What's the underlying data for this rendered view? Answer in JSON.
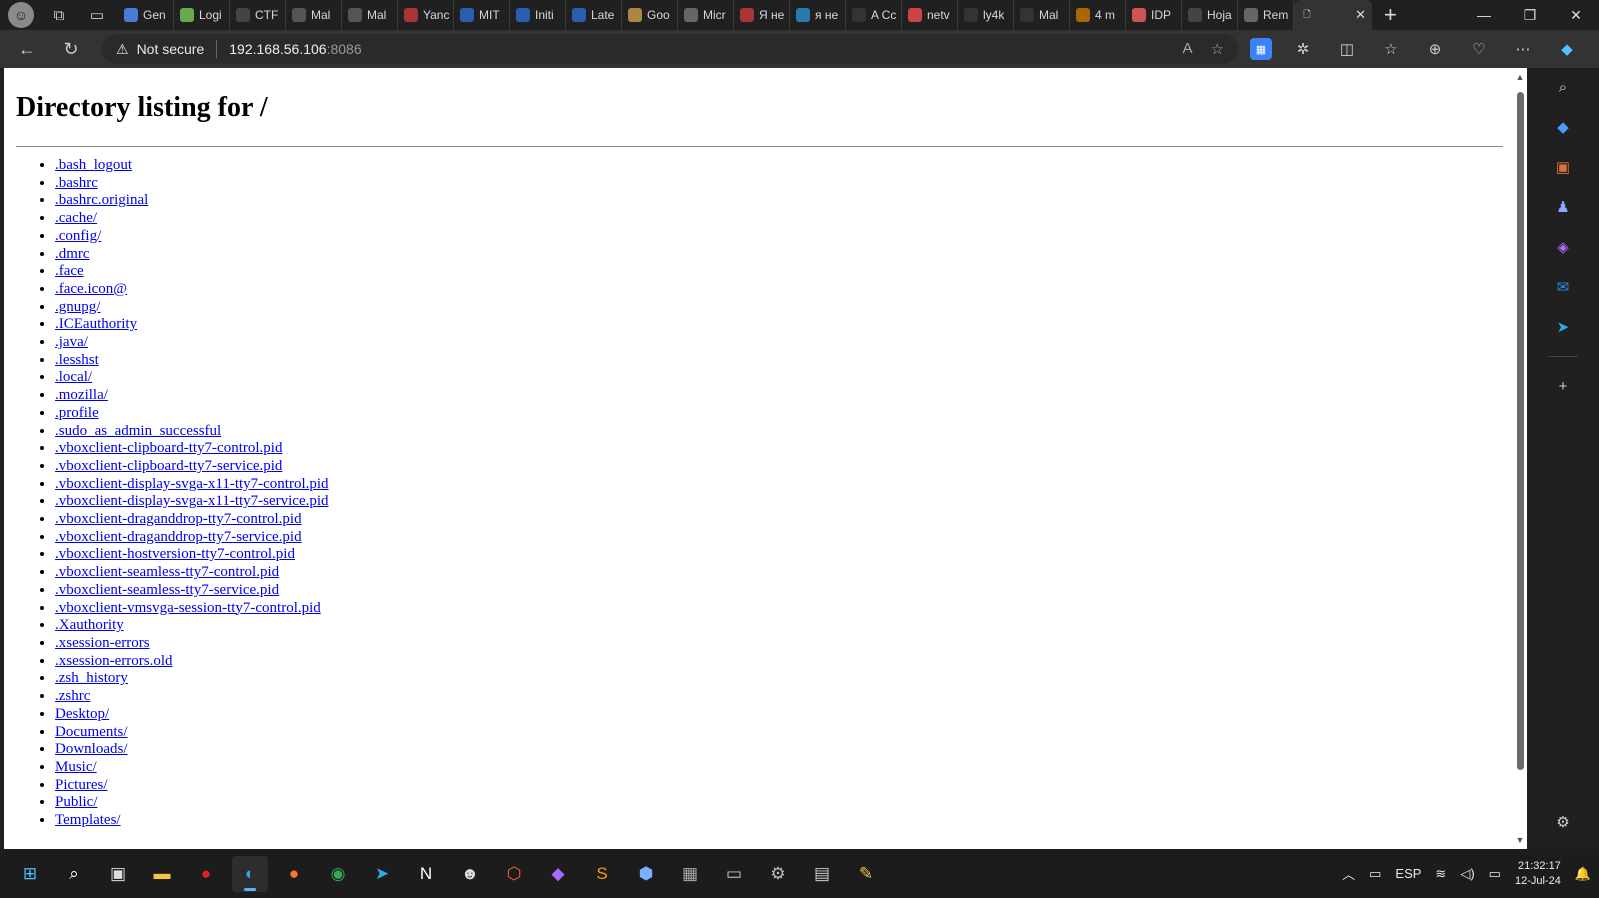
{
  "browser": {
    "tabs": [
      {
        "label": "Gen",
        "icon": "spark-icon",
        "color": "#4a7bd6"
      },
      {
        "label": "Logi",
        "icon": "cube-icon",
        "color": "#6aa84f"
      },
      {
        "label": "CTF",
        "icon": "flag-icon",
        "color": "#444444"
      },
      {
        "label": "Mal",
        "icon": "box-icon",
        "color": "#555555"
      },
      {
        "label": "Mal",
        "icon": "box-icon",
        "color": "#555555"
      },
      {
        "label": "Yanc",
        "icon": "yandex-icon",
        "color": "#a33"
      },
      {
        "label": "MIT",
        "icon": "m-icon",
        "color": "#2a5db0"
      },
      {
        "label": "Initi",
        "icon": "m-icon",
        "color": "#2a5db0"
      },
      {
        "label": "Late",
        "icon": "m-icon",
        "color": "#2a5db0"
      },
      {
        "label": "Goo",
        "icon": "leaf-icon",
        "color": "#a84"
      },
      {
        "label": "Micr",
        "icon": "g-icon",
        "color": "#666"
      },
      {
        "label": "Я не",
        "icon": "yandex-icon",
        "color": "#a33"
      },
      {
        "label": "я не",
        "icon": "search-icon",
        "color": "#2a7ab0"
      },
      {
        "label": "A Cc",
        "icon": "medium-icon",
        "color": "#333"
      },
      {
        "label": "netv",
        "icon": "ask-icon",
        "color": "#c44"
      },
      {
        "label": "ly4k",
        "icon": "github-icon",
        "color": "#333"
      },
      {
        "label": "Mal",
        "icon": "medium-icon",
        "color": "#333"
      },
      {
        "label": "4 m",
        "icon": "badge-icon",
        "color": "#a60"
      },
      {
        "label": "IDP",
        "icon": "blogger-icon",
        "color": "#c55"
      },
      {
        "label": "Hoja",
        "icon": "a-icon",
        "color": "#444"
      },
      {
        "label": "Rem",
        "icon": "g-icon",
        "color": "#666"
      }
    ],
    "active_tab_close": "✕",
    "new_tab": "+",
    "window_controls": {
      "minimize": "—",
      "restore": "❐",
      "close": "✕"
    },
    "back": "←",
    "reload": "↻",
    "security_label": "Not secure",
    "url_host": "192.168.56.106",
    "url_port": ":8086"
  },
  "page": {
    "title": "Directory listing for /",
    "entries": [
      ".bash_logout",
      ".bashrc",
      ".bashrc.original",
      ".cache/",
      ".config/",
      ".dmrc",
      ".face",
      ".face.icon@",
      ".gnupg/",
      ".ICEauthority",
      ".java/",
      ".lesshst",
      ".local/",
      ".mozilla/",
      ".profile",
      ".sudo_as_admin_successful",
      ".vboxclient-clipboard-tty7-control.pid",
      ".vboxclient-clipboard-tty7-service.pid",
      ".vboxclient-display-svga-x11-tty7-control.pid",
      ".vboxclient-display-svga-x11-tty7-service.pid",
      ".vboxclient-draganddrop-tty7-control.pid",
      ".vboxclient-draganddrop-tty7-service.pid",
      ".vboxclient-hostversion-tty7-control.pid",
      ".vboxclient-seamless-tty7-control.pid",
      ".vboxclient-seamless-tty7-service.pid",
      ".vboxclient-vmsvga-session-tty7-control.pid",
      ".Xauthority",
      ".xsession-errors",
      ".xsession-errors.old",
      ".zsh_history",
      ".zshrc",
      "Desktop/",
      "Documents/",
      "Downloads/",
      "Music/",
      "Pictures/",
      "Public/",
      "Templates/"
    ]
  },
  "taskbar": {
    "apps": [
      {
        "name": "start-button",
        "glyph": "⊞",
        "color": "#4cc2ff"
      },
      {
        "name": "search-button",
        "glyph": "⌕",
        "color": "#ffffff"
      },
      {
        "name": "task-view-button",
        "glyph": "▣",
        "color": "#dddddd"
      },
      {
        "name": "file-explorer-app",
        "glyph": "▬",
        "color": "#f5c542"
      },
      {
        "name": "antivirus-app",
        "glyph": "●",
        "color": "#d22"
      },
      {
        "name": "edge-app",
        "glyph": "◐",
        "color": "#2fa6e8",
        "active": true
      },
      {
        "name": "firefox-app",
        "glyph": "●",
        "color": "#ff7139"
      },
      {
        "name": "chrome-app",
        "glyph": "◉",
        "color": "#34a853"
      },
      {
        "name": "telegram-app",
        "glyph": "➤",
        "color": "#2aabee"
      },
      {
        "name": "notion-app",
        "glyph": "N",
        "color": "#ffffff"
      },
      {
        "name": "app-icon",
        "glyph": "☻",
        "color": "#dddddd"
      },
      {
        "name": "burp-app",
        "glyph": "⬡",
        "color": "#ff6633"
      },
      {
        "name": "visual-studio-app",
        "glyph": "◆",
        "color": "#a66bff"
      },
      {
        "name": "sublime-app",
        "glyph": "S",
        "color": "#ff9800"
      },
      {
        "name": "virtualbox-app",
        "glyph": "⬢",
        "color": "#7ab0ff"
      },
      {
        "name": "remote-app",
        "glyph": "▦",
        "color": "#aaaaaa"
      },
      {
        "name": "terminal-app",
        "glyph": "▭",
        "color": "#cccccc"
      },
      {
        "name": "settings-app",
        "glyph": "⚙",
        "color": "#bbbbbb"
      },
      {
        "name": "calculator-app",
        "glyph": "▤",
        "color": "#cccccc"
      },
      {
        "name": "tool-app",
        "glyph": "✎",
        "color": "#f5c542"
      }
    ],
    "language": "ESP",
    "time": "21:32:17",
    "date": "12-Jul-24"
  }
}
